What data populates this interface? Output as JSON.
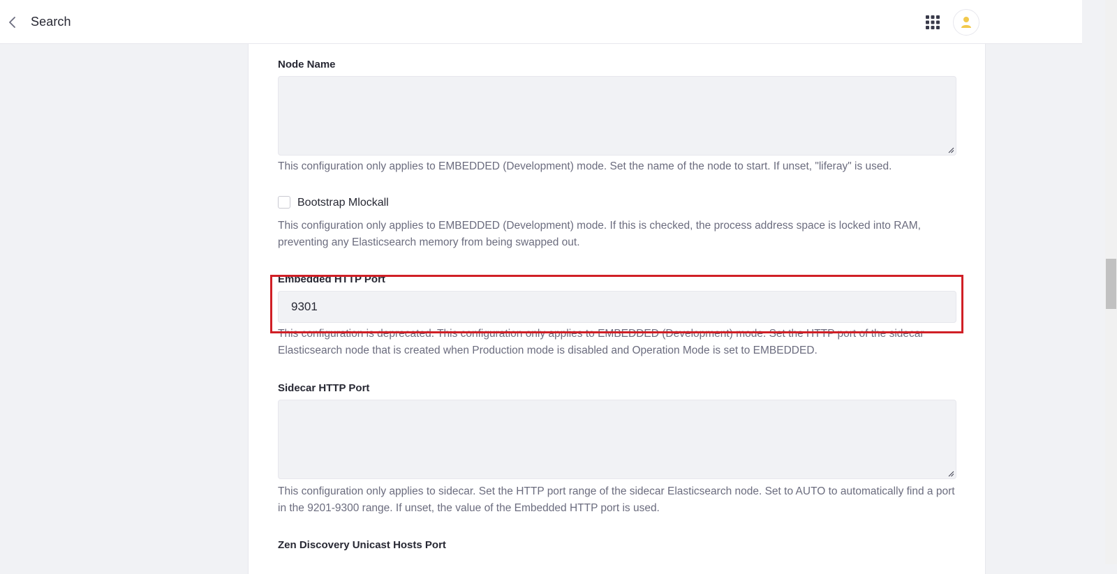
{
  "header": {
    "title": "Search"
  },
  "fields": {
    "node_name": {
      "label": "Node Name",
      "value": "",
      "help": "This configuration only applies to EMBEDDED (Development) mode. Set the name of the node to start. If unset, \"liferay\" is used."
    },
    "bootstrap_mlockall": {
      "label": "Bootstrap Mlockall",
      "checked": false,
      "help": "This configuration only applies to EMBEDDED (Development) mode. If this is checked, the process address space is locked into RAM, preventing any Elasticsearch memory from being swapped out."
    },
    "embedded_http_port": {
      "label": "Embedded HTTP Port",
      "value": "9301",
      "help": "This configuration is deprecated. This configuration only applies to EMBEDDED (Development) mode. Set the HTTP port of the sidecar Elasticsearch node that is created when Production mode is disabled and Operation Mode is set to EMBEDDED."
    },
    "sidecar_http_port": {
      "label": "Sidecar HTTP Port",
      "value": "",
      "help": "This configuration only applies to sidecar. Set the HTTP port range of the sidecar Elasticsearch node. Set to AUTO to automatically find a port in the 9201-9300 range. If unset, the value of the Embedded HTTP port is used."
    },
    "zen_discovery": {
      "label": "Zen Discovery Unicast Hosts Port"
    }
  },
  "colors": {
    "highlight": "#d01f26",
    "avatar_accent": "#f2c94c"
  },
  "icons": {
    "back": "chevron-left-icon",
    "apps": "grid-icon",
    "user": "user-icon"
  }
}
